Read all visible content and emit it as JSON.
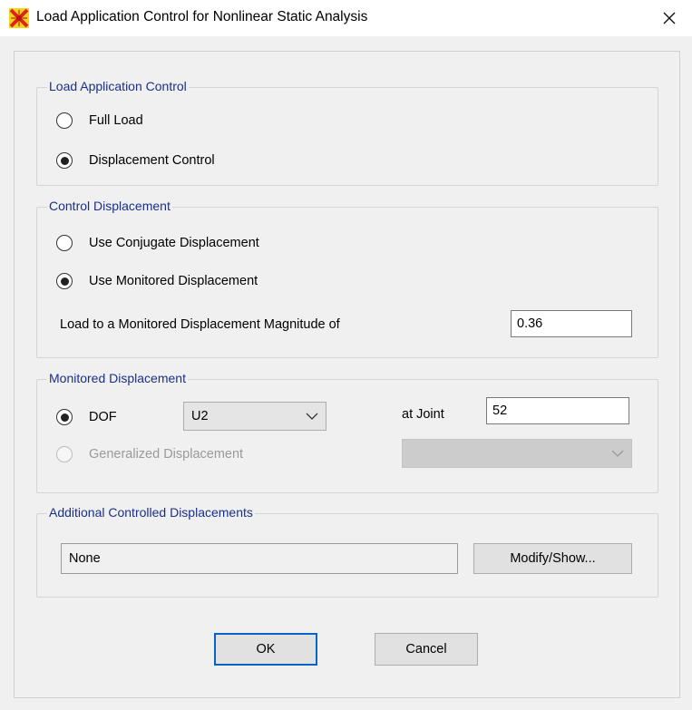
{
  "window": {
    "title": "Load Application Control for Nonlinear Static Analysis",
    "app_icon": "sap2000-icon",
    "close_glyph": "✕"
  },
  "load_application_control": {
    "group_title": "Load Application Control",
    "full_load_label": "Full Load",
    "full_load_selected": false,
    "displacement_control_label": "Displacement Control",
    "displacement_control_selected": true
  },
  "control_displacement": {
    "group_title": "Control Displacement",
    "use_conjugate_label": "Use Conjugate Displacement",
    "use_conjugate_selected": false,
    "use_monitored_label": "Use Monitored Displacement",
    "use_monitored_selected": true,
    "magnitude_label": "Load to a Monitored Displacement Magnitude of",
    "magnitude_value": "0.36"
  },
  "monitored_displacement": {
    "group_title": "Monitored Displacement",
    "dof_label": "DOF",
    "dof_selected": true,
    "dof_value": "U2",
    "at_joint_label": "at Joint",
    "joint_value": "52",
    "generalized_label": "Generalized Displacement",
    "generalized_selected": false,
    "generalized_enabled": false,
    "generalized_value": ""
  },
  "additional_controlled": {
    "group_title": "Additional Controlled Displacements",
    "value": "None",
    "modify_show_label": "Modify/Show..."
  },
  "buttons": {
    "ok_label": "OK",
    "cancel_label": "Cancel"
  }
}
